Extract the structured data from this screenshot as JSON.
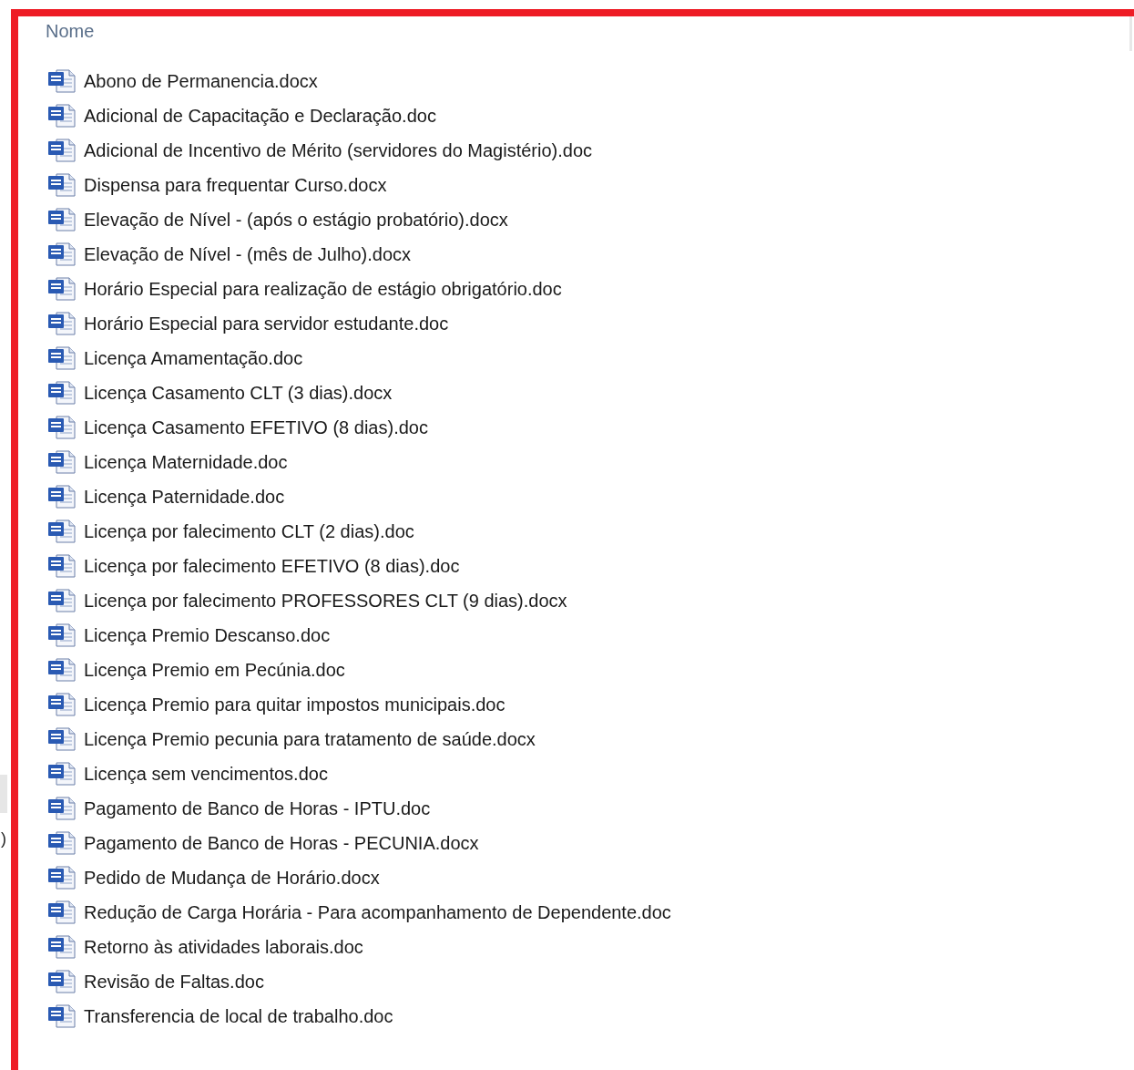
{
  "left_edge": {
    "fragment": ")"
  },
  "file_list": {
    "column_header": "Nome",
    "files": [
      {
        "name": "Abono de Permanencia.docx"
      },
      {
        "name": "Adicional de Capacitação e Declaração.doc"
      },
      {
        "name": "Adicional de Incentivo de Mérito (servidores do Magistério).doc"
      },
      {
        "name": "Dispensa para frequentar Curso.docx"
      },
      {
        "name": "Elevação de Nível - (após o estágio probatório).docx"
      },
      {
        "name": "Elevação de Nível - (mês de Julho).docx"
      },
      {
        "name": "Horário Especial para realização de estágio obrigatório.doc"
      },
      {
        "name": "Horário Especial para servidor estudante.doc"
      },
      {
        "name": "Licença Amamentação.doc"
      },
      {
        "name": "Licença Casamento CLT (3 dias).docx"
      },
      {
        "name": "Licença Casamento EFETIVO (8 dias).doc"
      },
      {
        "name": "Licença Maternidade.doc"
      },
      {
        "name": "Licença Paternidade.doc"
      },
      {
        "name": "Licença por falecimento CLT (2 dias).doc"
      },
      {
        "name": "Licença por falecimento EFETIVO (8 dias).doc"
      },
      {
        "name": "Licença por falecimento PROFESSORES CLT (9 dias).docx"
      },
      {
        "name": "Licença Premio Descanso.doc"
      },
      {
        "name": "Licença Premio em Pecúnia.doc"
      },
      {
        "name": "Licença Premio para quitar impostos municipais.doc"
      },
      {
        "name": "Licença Premio pecunia para tratamento de saúde.docx"
      },
      {
        "name": "Licença sem vencimentos.doc"
      },
      {
        "name": "Pagamento de Banco de Horas - IPTU.doc"
      },
      {
        "name": "Pagamento de Banco de Horas - PECUNIA.docx"
      },
      {
        "name": "Pedido de Mudança de Horário.docx"
      },
      {
        "name": "Redução de Carga Horária - Para acompanhamento de Dependente.doc"
      },
      {
        "name": "Retorno às atividades laborais.doc"
      },
      {
        "name": "Revisão de Faltas.doc"
      },
      {
        "name": "Transferencia de local de trabalho.doc"
      }
    ]
  }
}
